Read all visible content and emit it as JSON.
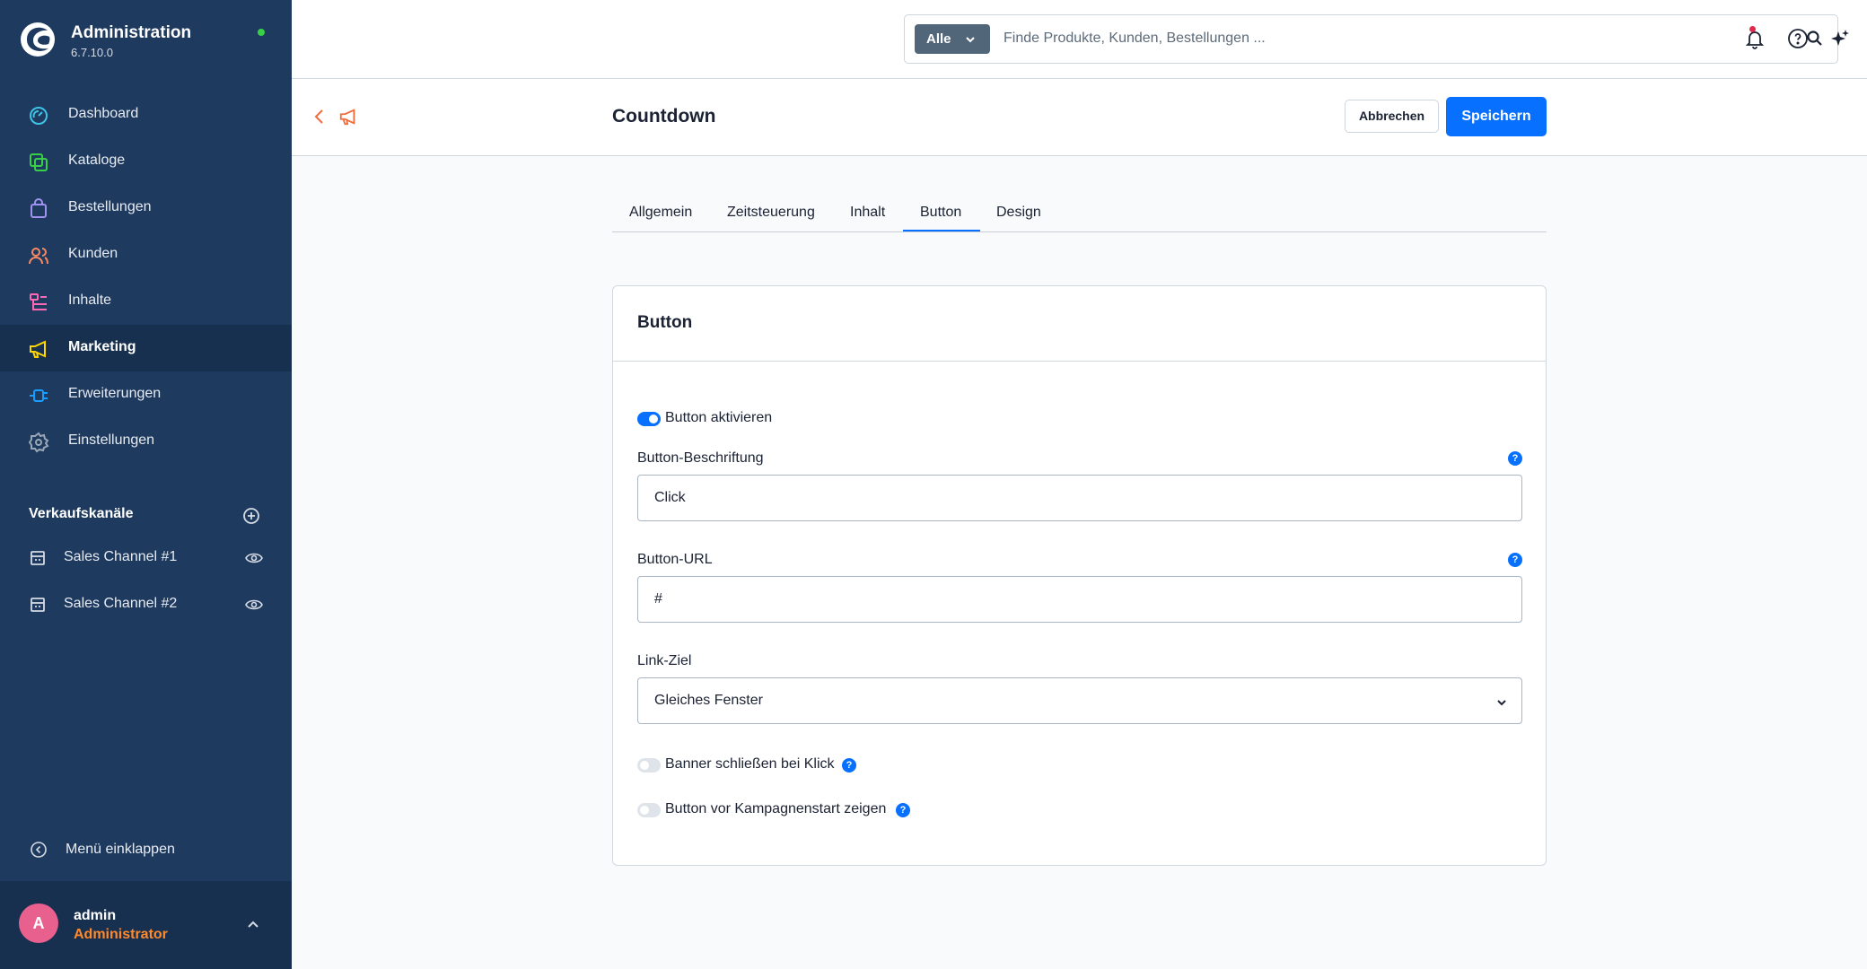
{
  "app": {
    "title": "Administration",
    "version": "6.7.10.0"
  },
  "nav": [
    {
      "label": "Dashboard",
      "icon": "dashboard-icon",
      "color": "#3ec4e6"
    },
    {
      "label": "Kataloge",
      "icon": "catalog-icon",
      "color": "#37d046"
    },
    {
      "label": "Bestellungen",
      "icon": "shopping-bag-icon",
      "color": "#a092f0"
    },
    {
      "label": "Kunden",
      "icon": "customers-icon",
      "color": "#f88962"
    },
    {
      "label": "Inhalte",
      "icon": "content-icon",
      "color": "#ff68b4"
    },
    {
      "label": "Marketing",
      "icon": "megaphone-icon",
      "color": "#ffd700",
      "active": true
    },
    {
      "label": "Erweiterungen",
      "icon": "plugin-icon",
      "color": "#189eff"
    },
    {
      "label": "Einstellungen",
      "icon": "gear-icon",
      "color": "#9aa8b5"
    }
  ],
  "sales_channels": {
    "title": "Verkaufskanäle",
    "items": [
      {
        "label": "Sales Channel #1"
      },
      {
        "label": "Sales Channel #2"
      }
    ]
  },
  "collapse_label": "Menü einklappen",
  "user": {
    "initial": "A",
    "name": "admin",
    "role": "Administrator"
  },
  "search": {
    "filter": "Alle",
    "placeholder": "Finde Produkte, Kunden, Bestellungen ..."
  },
  "page": {
    "title": "Countdown",
    "cancel": "Abbrechen",
    "save": "Speichern"
  },
  "tabs": [
    "Allgemein",
    "Zeitsteuerung",
    "Inhalt",
    "Button",
    "Design"
  ],
  "active_tab": "Button",
  "card": {
    "title": "Button",
    "enable_label": "Button aktivieren",
    "enable_on": true,
    "label_field": {
      "label": "Button-Beschriftung",
      "value": "Click"
    },
    "url_field": {
      "label": "Button-URL",
      "value": "#"
    },
    "target_field": {
      "label": "Link-Ziel",
      "value": "Gleiches Fenster"
    },
    "close_banner": {
      "label": "Banner schließen bei Klick",
      "on": false
    },
    "show_before": {
      "label": "Button vor Kampagnenstart zeigen",
      "on": false
    },
    "help_glyph": "?"
  },
  "colors": {
    "sidebar": "#1f3a5f",
    "primary": "#0870ff",
    "accent_orange": "#ff8a2c"
  }
}
